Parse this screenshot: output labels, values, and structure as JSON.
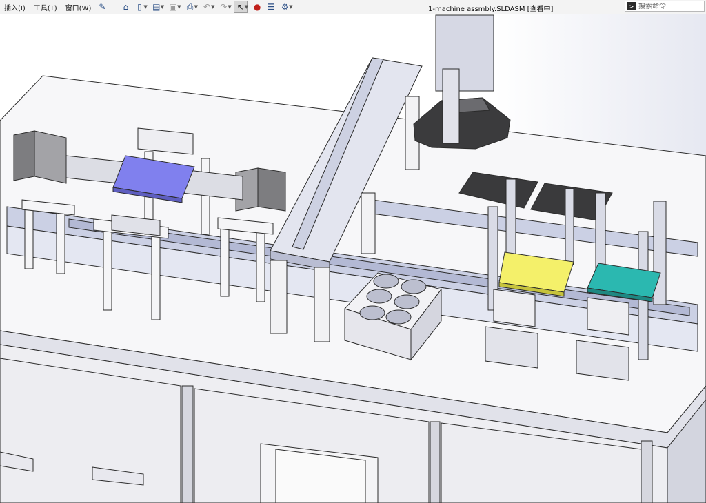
{
  "menu": {
    "items": [
      "插入(I)",
      "工具(T)",
      "窗口(W)"
    ]
  },
  "window": {
    "title": "1-machine assmbly.SLDASM [查看中]"
  },
  "search": {
    "placeholder": "搜索命令"
  },
  "icons": {
    "toolbar": [
      "home-icon",
      "new-document-icon",
      "open-file-icon",
      "save-icon",
      "print-icon",
      "undo-icon",
      "redo-icon",
      "select-pointer-icon",
      "rebuild-icon",
      "file-properties-icon",
      "options-gear-icon"
    ],
    "view": [
      "zoom-to-fit-icon",
      "zoom-area-icon",
      "previous-view-icon",
      "section-view-icon",
      "view-orientation-icon",
      "display-style-icon"
    ]
  },
  "colors": {
    "fixture_blue": "#8080ee",
    "fixture_yellow": "#f4f06a",
    "fixture_teal": "#2bb8b0",
    "dark_parts": "#3a3a3c",
    "frame_gray": "#d9dbe6"
  }
}
